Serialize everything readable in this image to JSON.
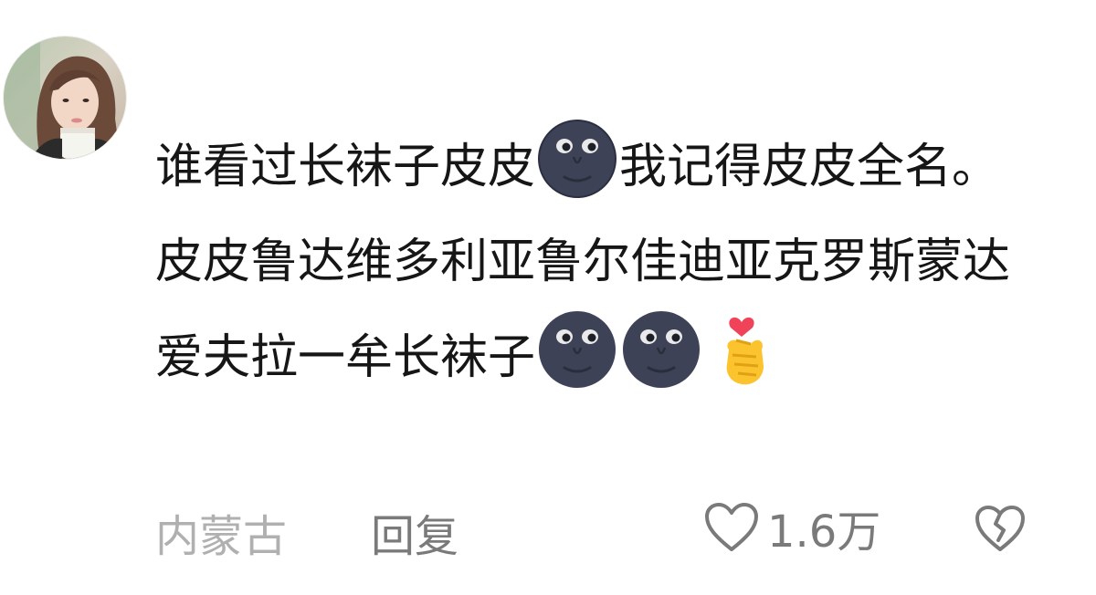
{
  "comment": {
    "avatar_icon": "user-avatar-photo",
    "text_segments": [
      "谁看过长袜子皮皮",
      "我记得皮皮全名。皮皮鲁达维多利亚鲁尔佳迪亚克罗斯蒙达爱夫拉一牟长袜子"
    ],
    "emojis": [
      "new-moon-face-emoji",
      "new-moon-face-emoji",
      "new-moon-face-emoji",
      "finger-heart-emoji"
    ]
  },
  "footer": {
    "location": "内蒙古",
    "reply_label": "回复",
    "like_count": "1.6万",
    "like_icon": "heart-outline-icon",
    "dislike_icon": "broken-heart-icon"
  },
  "colors": {
    "text": "#161616",
    "meta": "#b0b0b0",
    "action": "#7a7a7a",
    "moon": "#3b3f52"
  }
}
